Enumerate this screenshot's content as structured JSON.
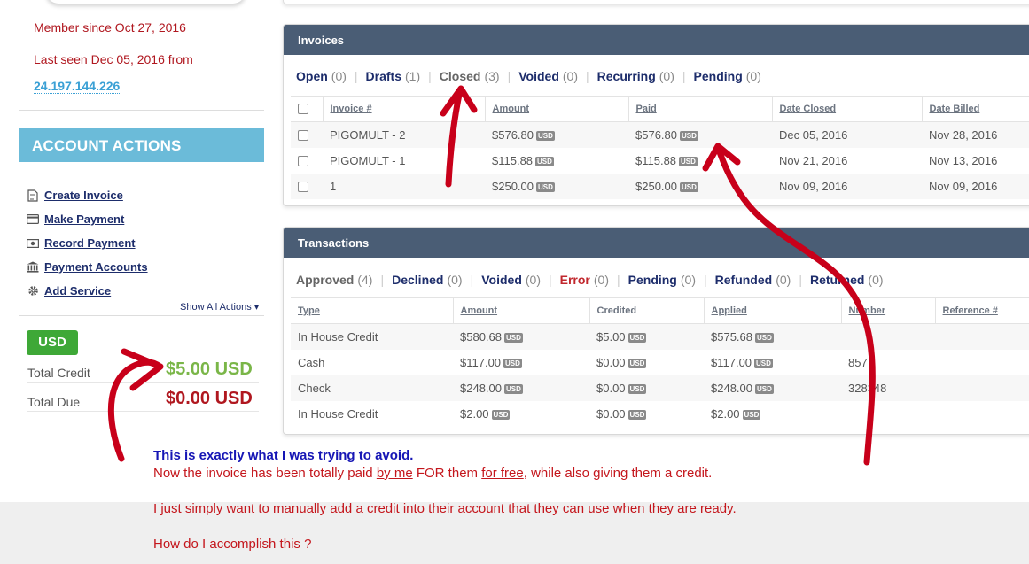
{
  "sidebar": {
    "member_since": "Member since Oct 27, 2016",
    "last_seen": "Last seen Dec 05, 2016 from",
    "ip": "24.197.144.226",
    "actions_title": "ACCOUNT ACTIONS",
    "actions": [
      {
        "label": "Create Invoice",
        "icon": "document-icon"
      },
      {
        "label": "Make Payment",
        "icon": "credit-card-icon"
      },
      {
        "label": "Record Payment",
        "icon": "cash-icon"
      },
      {
        "label": "Payment Accounts",
        "icon": "bank-icon"
      },
      {
        "label": "Add Service",
        "icon": "gear-icon"
      }
    ],
    "show_all": "Show All Actions",
    "currency_button": "USD",
    "total_credit_label": "Total Credit",
    "total_credit_value": "$5.00 USD",
    "total_due_label": "Total Due",
    "total_due_value": "$0.00 USD"
  },
  "invoices": {
    "title": "Invoices",
    "filters": [
      {
        "label": "Open",
        "count": "(0)"
      },
      {
        "label": "Drafts",
        "count": "(1)"
      },
      {
        "label": "Closed",
        "count": "(3)"
      },
      {
        "label": "Voided",
        "count": "(0)"
      },
      {
        "label": "Recurring",
        "count": "(0)"
      },
      {
        "label": "Pending",
        "count": "(0)"
      }
    ],
    "columns": [
      "Invoice #",
      "Amount",
      "Paid",
      "Date Closed",
      "Date Billed"
    ],
    "rows": [
      {
        "invoice": "PIGOMULT - 2",
        "amount": "$576.80",
        "paid": "$576.80",
        "closed": "Dec 05, 2016",
        "billed": "Nov 28, 2016"
      },
      {
        "invoice": "PIGOMULT - 1",
        "amount": "$115.88",
        "paid": "$115.88",
        "closed": "Nov 21, 2016",
        "billed": "Nov 13, 2016"
      },
      {
        "invoice": "1",
        "amount": "$250.00",
        "paid": "$250.00",
        "closed": "Nov 09, 2016",
        "billed": "Nov 09, 2016"
      }
    ],
    "currency_tag": "USD"
  },
  "transactions": {
    "title": "Transactions",
    "filters": [
      {
        "label": "Approved",
        "count": "(4)"
      },
      {
        "label": "Declined",
        "count": "(0)"
      },
      {
        "label": "Voided",
        "count": "(0)"
      },
      {
        "label": "Error",
        "count": "(0)"
      },
      {
        "label": "Pending",
        "count": "(0)"
      },
      {
        "label": "Refunded",
        "count": "(0)"
      },
      {
        "label": "Returned",
        "count": "(0)"
      }
    ],
    "columns": [
      "Type",
      "Amount",
      "Credited",
      "Applied",
      "Number",
      "Reference #"
    ],
    "rows": [
      {
        "type": "In House Credit",
        "amount": "$580.68",
        "credited": "$5.00",
        "applied": "$575.68",
        "number": ""
      },
      {
        "type": "Cash",
        "amount": "$117.00",
        "credited": "$0.00",
        "applied": "$117.00",
        "number": "857"
      },
      {
        "type": "Check",
        "amount": "$248.00",
        "credited": "$0.00",
        "applied": "$248.00",
        "number": "328348"
      },
      {
        "type": "In House Credit",
        "amount": "$2.00",
        "credited": "$0.00",
        "applied": "$2.00",
        "number": ""
      }
    ],
    "currency_tag": "USD"
  },
  "note": {
    "line1": "This is exactly what I was trying to avoid.",
    "line2_a": "Now the invoice has been totally paid ",
    "line2_b": "by me",
    "line2_c": " FOR them ",
    "line2_d": "for free",
    "line2_e": ", while also giving them a credit.",
    "line3_a": "I just simply want to ",
    "line3_b": "manually add",
    "line3_c": " a credit ",
    "line3_d": "into",
    "line3_e": " their account that they can use ",
    "line3_f": "when they are ready",
    "line3_g": ".",
    "line4": "How do I accomplish this ?"
  },
  "colors": {
    "panel_header": "#4a5d75",
    "account_actions": "#6bbbd9",
    "credit_green": "#7ab648",
    "due_red": "#b0171f",
    "link_navy": "#1d2d6b",
    "annotation_red": "#c4161c"
  }
}
